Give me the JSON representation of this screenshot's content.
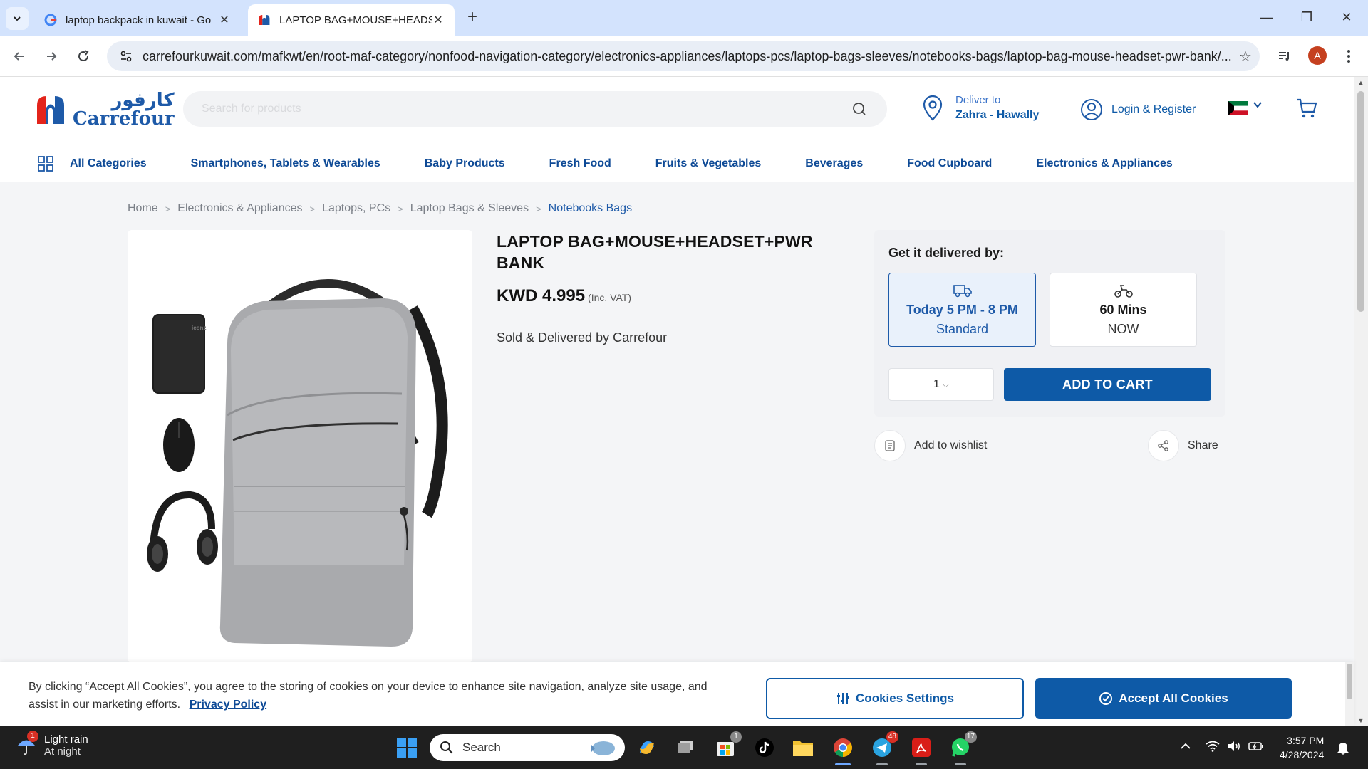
{
  "browser": {
    "tabs": [
      {
        "title": "laptop backpack in kuwait - Go",
        "favicon": "google-g-icon",
        "active": false
      },
      {
        "title": "LAPTOP BAG+MOUSE+HEADSE",
        "favicon": "carrefour-icon",
        "active": true
      }
    ],
    "url": "carrefourkuwait.com/mafkwt/en/root-maf-category/nonfood-navigation-category/electronics-appliances/laptops-pcs/laptop-bags-sleeves/notebooks-bags/laptop-bag-mouse-headset-pwr-bank/...",
    "profile_initial": "A"
  },
  "header": {
    "logo_arabic": "كارفور",
    "logo_latin": "Carrefour",
    "search_placeholder": "Search for products",
    "deliver_label": "Deliver to",
    "deliver_location": "Zahra - Hawally",
    "login_label": "Login & Register"
  },
  "categories": [
    "All Categories",
    "Smartphones, Tablets & Wearables",
    "Baby Products",
    "Fresh Food",
    "Fruits & Vegetables",
    "Beverages",
    "Food Cupboard",
    "Electronics & Appliances"
  ],
  "breadcrumb": [
    "Home",
    "Electronics & Appliances",
    "Laptops, PCs",
    "Laptop Bags & Sleeves",
    "Notebooks Bags"
  ],
  "product": {
    "title": "LAPTOP BAG+MOUSE+HEADSET+PWR BANK",
    "price": "KWD 4.995",
    "vat": "(Inc. VAT)",
    "sold_by": "Sold & Delivered by Carrefour",
    "powerbank_text": "iconz"
  },
  "delivery": {
    "heading": "Get it delivered by:",
    "options": [
      {
        "line1": "Today 5 PM - 8 PM",
        "line2": "Standard",
        "selected": true
      },
      {
        "line1": "60 Mins",
        "line2": "NOW",
        "selected": false
      }
    ],
    "quantity": "1",
    "add_to_cart": "ADD TO CART",
    "wishlist": "Add to wishlist",
    "share": "Share"
  },
  "cookie": {
    "message": "By clicking “Accept All Cookies”, you agree to the storing of cookies on your device to enhance site navigation, analyze site usage, and assist in our marketing efforts.",
    "privacy": "Privacy Policy",
    "settings": "Cookies Settings",
    "accept": "Accept All Cookies"
  },
  "taskbar": {
    "weather_line1": "Light rain",
    "weather_line2": "At night",
    "weather_badge": "1",
    "search_label": "Search",
    "badges": {
      "store": "1",
      "telegram": "48",
      "whatsapp": "17"
    },
    "time": "3:57 PM",
    "date": "4/28/2024"
  },
  "colors": {
    "brand_blue": "#0e5aa7",
    "carrefour_red": "#e3241b",
    "tab_strip": "#d3e3fd"
  }
}
